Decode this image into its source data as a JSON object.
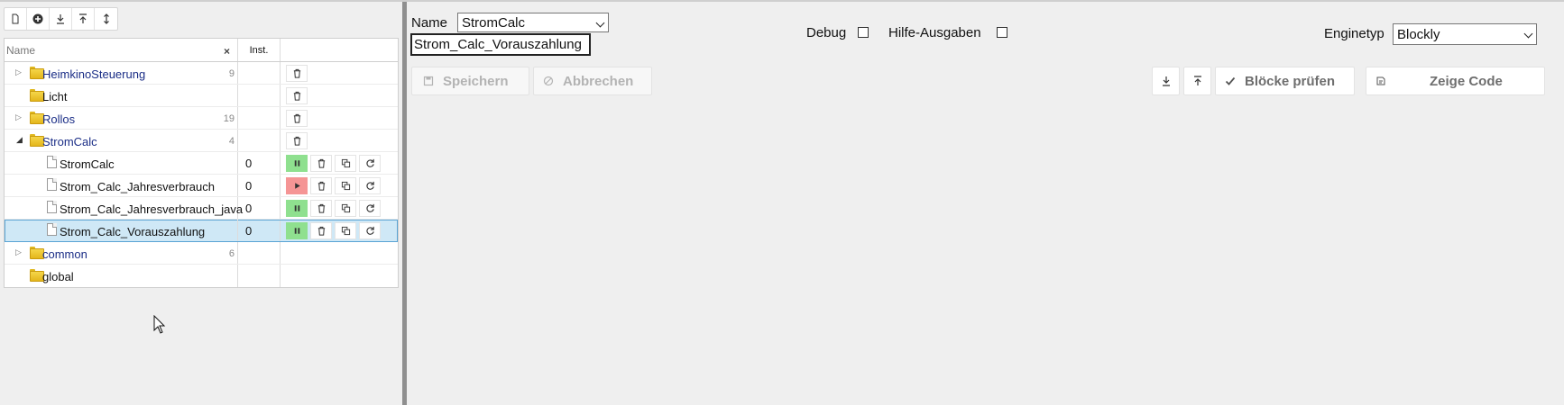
{
  "toolbar": {
    "icons": [
      "new-file-icon",
      "add-folder-icon",
      "download-icon",
      "upload-icon",
      "expand-collapse-icon"
    ]
  },
  "tree": {
    "name_placeholder": "Name",
    "clear_label": "×",
    "inst_header": "Inst.",
    "folders": [
      {
        "label": "HeimkinoSteuerung",
        "count": "9"
      },
      {
        "label": "Licht",
        "count": ""
      },
      {
        "label": "Rollos",
        "count": "19"
      },
      {
        "label": "StromCalc",
        "count": "4"
      }
    ],
    "scripts": [
      {
        "label": "StromCalc",
        "inst": "0",
        "state": "paused"
      },
      {
        "label": "Strom_Calc_Jahresverbrauch",
        "inst": "0",
        "state": "stopped"
      },
      {
        "label": "Strom_Calc_Jahresverbrauch_java",
        "inst": "0",
        "state": "paused"
      },
      {
        "label": "Strom_Calc_Vorauszahlung",
        "inst": "0",
        "state": "paused",
        "selected": true
      }
    ],
    "folders_bottom": [
      {
        "label": "common",
        "count": "6"
      },
      {
        "label": "global",
        "count": ""
      }
    ]
  },
  "editor": {
    "name_label": "Name",
    "name_select_value": "StromCalc",
    "script_name_value": "Strom_Calc_Vorauszahlung",
    "debug_label": "Debug",
    "verbose_label": "Hilfe-Ausgaben",
    "engine_label": "Enginetyp",
    "engine_value": "Blockly",
    "save_label": "Speichern",
    "cancel_label": "Abbrechen",
    "check_blocks_label": "Blöcke prüfen",
    "show_code_label": "Zeige Code"
  },
  "colors": {
    "selected_row": "#cfe8f6",
    "pause_green": "#8fe08f",
    "play_red": "#f59595",
    "folder_label": "#1a2d86"
  }
}
